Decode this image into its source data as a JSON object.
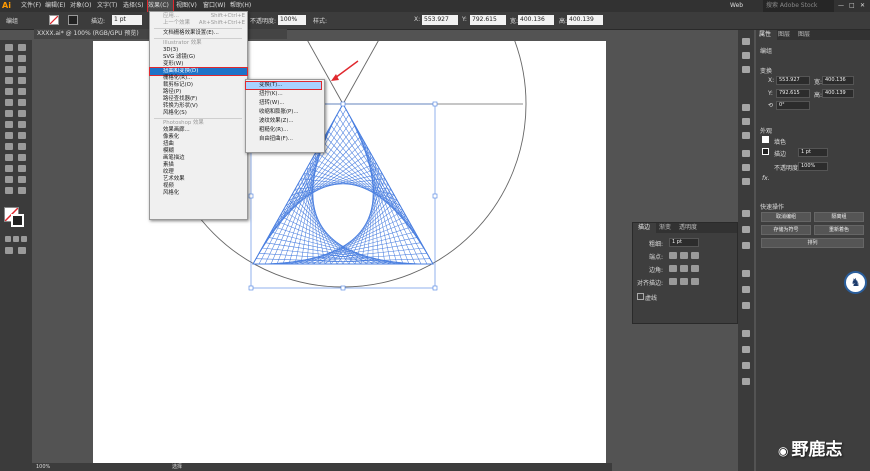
{
  "app": {
    "logo": "Ai",
    "workspace": "Web",
    "search_placeholder": "搜索 Adobe Stock"
  },
  "menubar": {
    "items": [
      "文件(F)",
      "编辑(E)",
      "对象(O)",
      "文字(T)",
      "选择(S)",
      "效果(C)",
      "视图(V)",
      "窗口(W)",
      "帮助(H)"
    ],
    "active": "效果(C)"
  },
  "options_bar": {
    "selection": "编组",
    "stroke_label": "描边:",
    "stroke_value": "1 pt",
    "opacity_label": "不透明度:",
    "opacity_value": "100%",
    "style_label": "样式:",
    "x": "553.927",
    "y": "792.615",
    "w": "400.136",
    "h": "400.139"
  },
  "document_tab": {
    "title": "XXXX.ai* @ 100% (RGB/GPU 预览)"
  },
  "effect_menu": {
    "items": [
      {
        "label": "应用...",
        "shortcut": "Shift+Ctrl+E",
        "disabled": true
      },
      {
        "label": "上一个效果",
        "shortcut": "Alt+Shift+Ctrl+E",
        "disabled": true
      },
      {
        "separator": true
      },
      {
        "label": "文档栅格效果设置(E)..."
      },
      {
        "separator": true
      },
      {
        "label": "Illustrator 效果",
        "header": true
      },
      {
        "label": "3D(3)"
      },
      {
        "label": "SVG 滤镜(G)"
      },
      {
        "label": "变形(W)"
      },
      {
        "label": "扭曲和变换(D)",
        "highlight": true
      },
      {
        "label": "栅格化(R)..."
      },
      {
        "label": "裁剪标记(O)"
      },
      {
        "label": "路径(P)"
      },
      {
        "label": "路径查找器(F)"
      },
      {
        "label": "转换为形状(V)"
      },
      {
        "label": "风格化(S)"
      },
      {
        "separator": true
      },
      {
        "label": "Photoshop 效果",
        "header": true
      },
      {
        "label": "效果画廊..."
      },
      {
        "label": "像素化"
      },
      {
        "label": "扭曲"
      },
      {
        "label": "模糊"
      },
      {
        "label": "画笔描边"
      },
      {
        "label": "素描"
      },
      {
        "label": "纹理"
      },
      {
        "label": "艺术效果"
      },
      {
        "label": "视频"
      },
      {
        "label": "风格化"
      }
    ]
  },
  "distort_submenu": {
    "items": [
      "变换(T)...",
      "扭拧(K)...",
      "扭转(W)...",
      "收缩和膨胀(P)...",
      "波纹效果(Z)...",
      "粗糙化(R)...",
      "自由扭曲(F)..."
    ],
    "highlight": "变换(T)..."
  },
  "properties_panel": {
    "tabs": [
      "属性",
      "图层",
      "图层"
    ],
    "section_transform": "变换",
    "x": "553.927",
    "y": "792.615",
    "w": "400.136",
    "h": "400.139",
    "angle": "0°",
    "section_appearance": "外观",
    "fill_label": "填色",
    "stroke_label": "描边",
    "stroke_value": "1 pt",
    "opacity_label": "不透明度",
    "opacity_value": "100%",
    "fx": "fx.",
    "section_quick": "快速操作",
    "quick_buttons": [
      "取消编组",
      "隔离组",
      "存储为符号",
      "重新着色",
      "排列"
    ]
  },
  "stroke_panel": {
    "tabs": [
      "描边",
      "渐变",
      "透明度"
    ],
    "weight_label": "粗细:",
    "weight_value": "1 pt",
    "cap_label": "端点:",
    "corner_label": "边角:",
    "align_label": "对齐描边:",
    "dashed_label": "虚线"
  },
  "status": {
    "zoom": "100%",
    "tool": "选择"
  },
  "colors": {
    "accent_red": "#e0282e",
    "stroke_blue": "#4a7fe0",
    "menu_highlight": "#1e73c8"
  },
  "watermark": {
    "text": "野鹿志"
  }
}
